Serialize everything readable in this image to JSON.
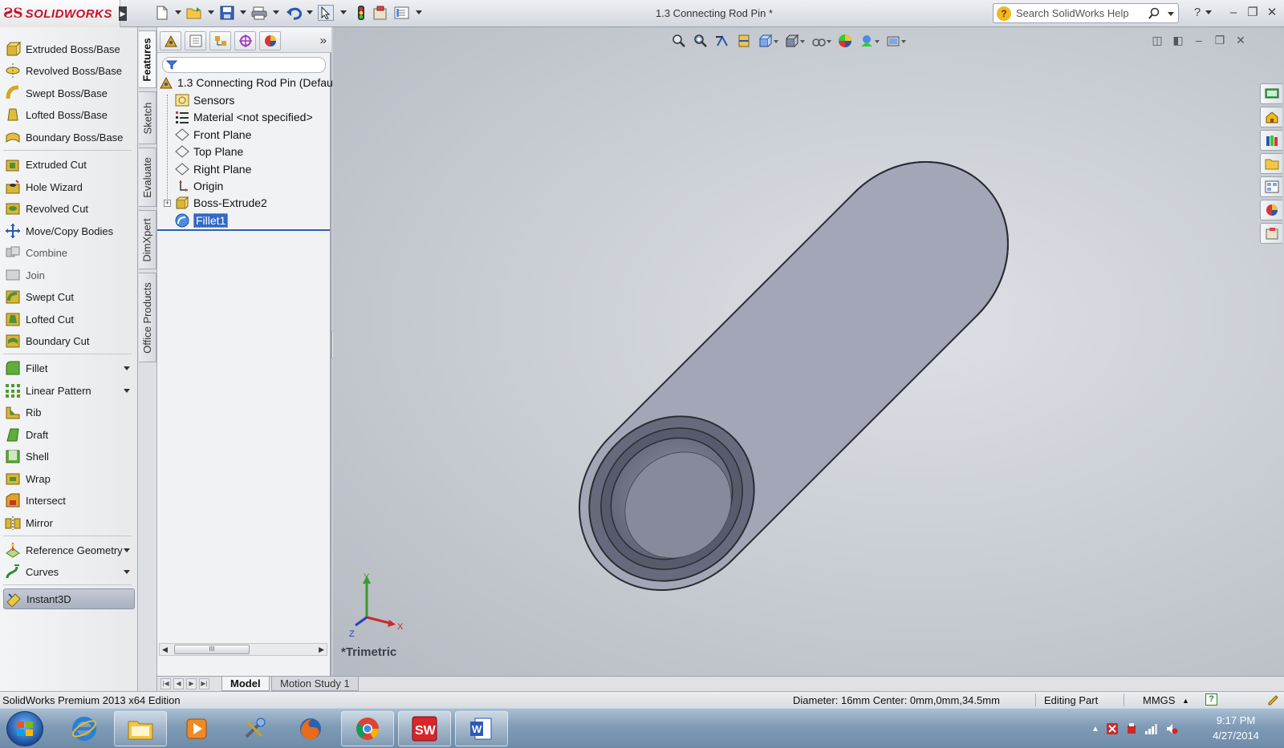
{
  "titlebar": {
    "brand": "SOLIDWORKS",
    "document_title": "1.3 Connecting Rod Pin *",
    "help_search_placeholder": "Search SolidWorks Help"
  },
  "command_manager": {
    "items": [
      {
        "label": "Extruded Boss/Base",
        "icon": "extruded-boss-icon"
      },
      {
        "label": "Revolved Boss/Base",
        "icon": "revolved-boss-icon"
      },
      {
        "label": "Swept Boss/Base",
        "icon": "swept-boss-icon"
      },
      {
        "label": "Lofted Boss/Base",
        "icon": "lofted-boss-icon"
      },
      {
        "label": "Boundary Boss/Base",
        "icon": "boundary-boss-icon"
      },
      {
        "label": "Extruded Cut",
        "icon": "extruded-cut-icon"
      },
      {
        "label": "Hole Wizard",
        "icon": "hole-wizard-icon"
      },
      {
        "label": "Revolved Cut",
        "icon": "revolved-cut-icon"
      },
      {
        "label": "Move/Copy Bodies",
        "icon": "move-copy-icon"
      },
      {
        "label": "Combine",
        "icon": "combine-icon"
      },
      {
        "label": "Join",
        "icon": "join-icon"
      },
      {
        "label": "Swept Cut",
        "icon": "swept-cut-icon"
      },
      {
        "label": "Lofted Cut",
        "icon": "lofted-cut-icon"
      },
      {
        "label": "Boundary Cut",
        "icon": "boundary-cut-icon"
      },
      {
        "label": "Fillet",
        "icon": "fillet-icon"
      },
      {
        "label": "Linear Pattern",
        "icon": "linear-pattern-icon"
      },
      {
        "label": "Rib",
        "icon": "rib-icon"
      },
      {
        "label": "Draft",
        "icon": "draft-icon"
      },
      {
        "label": "Shell",
        "icon": "shell-icon"
      },
      {
        "label": "Wrap",
        "icon": "wrap-icon"
      },
      {
        "label": "Intersect",
        "icon": "intersect-icon"
      },
      {
        "label": "Mirror",
        "icon": "mirror-icon"
      },
      {
        "label": "Reference Geometry",
        "icon": "reference-geometry-icon"
      },
      {
        "label": "Curves",
        "icon": "curves-icon"
      },
      {
        "label": "Instant3D",
        "icon": "instant3d-icon"
      }
    ]
  },
  "vertical_tabs": [
    "Features",
    "Sketch",
    "Evaluate",
    "DimXpert",
    "Office Products"
  ],
  "feature_tree": {
    "root": "1.3 Connecting Rod Pin  (Defau",
    "items": [
      {
        "label": "Sensors",
        "icon": "sensors-icon"
      },
      {
        "label": "Material <not specified>",
        "icon": "material-icon"
      },
      {
        "label": "Front Plane",
        "icon": "plane-icon"
      },
      {
        "label": "Top Plane",
        "icon": "plane-icon"
      },
      {
        "label": "Right Plane",
        "icon": "plane-icon"
      },
      {
        "label": "Origin",
        "icon": "origin-icon"
      },
      {
        "label": "Boss-Extrude2",
        "icon": "boss-extrude-icon"
      },
      {
        "label": "Fillet1",
        "icon": "fillet-feature-icon"
      }
    ],
    "scroll_thumb": "III"
  },
  "viewport": {
    "view_name": "*Trimetric",
    "triad": {
      "x": "X",
      "y": "Y",
      "z": "Z"
    }
  },
  "bottom_tabs": [
    {
      "label": "Model",
      "active": true
    },
    {
      "label": "Motion Study 1",
      "active": false
    }
  ],
  "statusbar": {
    "edition": "SolidWorks Premium 2013 x64 Edition",
    "measure": "Diameter: 16mm  Center: 0mm,0mm,34.5mm",
    "mode": "Editing Part",
    "units": "MMGS",
    "help": "?"
  },
  "taskbar": {
    "time": "9:17 PM",
    "date": "4/27/2014"
  },
  "colors": {
    "accent": "#3169c6",
    "brand": "#c8102e",
    "part_body": "#8a8d9e"
  }
}
